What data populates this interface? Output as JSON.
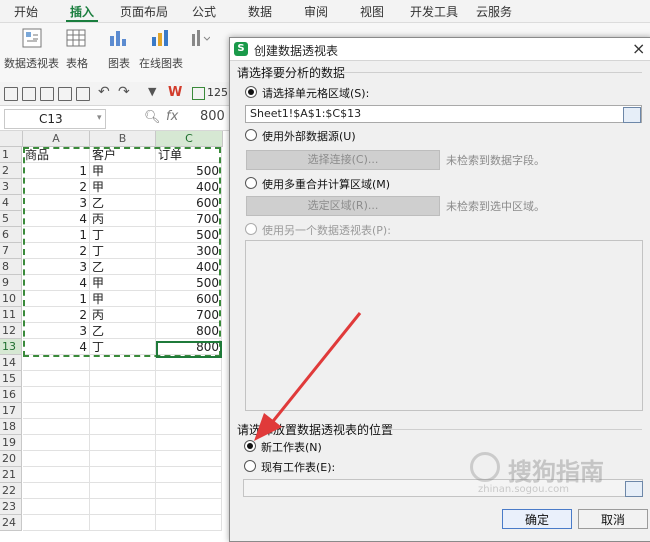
{
  "ribbon": {
    "tabs": [
      "开始",
      "插入",
      "页面布局",
      "公式",
      "数据",
      "审阅",
      "视图",
      "开发工具",
      "云服务"
    ],
    "active_tab": "插入",
    "buttons": [
      "数据透视表",
      "表格",
      "图表",
      "在线图表"
    ]
  },
  "formula_bar": {
    "cell_ref": "C13",
    "fx": "fx",
    "value": "800",
    "zoom": "125"
  },
  "sheet": {
    "columns": [
      "A",
      "B",
      "C"
    ],
    "rows": [
      "1",
      "2",
      "3",
      "4",
      "5",
      "6",
      "7",
      "8",
      "9",
      "10",
      "11",
      "12",
      "13",
      "14",
      "15",
      "16",
      "17",
      "18",
      "19",
      "20",
      "21",
      "22",
      "23",
      "24"
    ],
    "header": [
      "商品",
      "客户",
      "订单"
    ],
    "data": [
      [
        "1",
        "甲",
        "500"
      ],
      [
        "2",
        "甲",
        "400"
      ],
      [
        "3",
        "乙",
        "600"
      ],
      [
        "4",
        "丙",
        "700"
      ],
      [
        "1",
        "丁",
        "500"
      ],
      [
        "2",
        "丁",
        "300"
      ],
      [
        "3",
        "乙",
        "400"
      ],
      [
        "4",
        "甲",
        "500"
      ],
      [
        "1",
        "甲",
        "600"
      ],
      [
        "2",
        "丙",
        "700"
      ],
      [
        "3",
        "乙",
        "800"
      ],
      [
        "4",
        "丁",
        "800"
      ]
    ]
  },
  "dialog": {
    "title": "创建数据透视表",
    "section1": "请选择要分析的数据",
    "opt_range": "请选择单元格区域(S):",
    "range_value": "Sheet1!$A$1:$C$13",
    "opt_external": "使用外部数据源(U)",
    "btn_connect": "选择连接(C)...",
    "hint_connect": "未检索到数据字段。",
    "opt_multi": "使用多重合并计算区域(M)",
    "btn_select": "选定区域(R)...",
    "hint_select": "未检索到选中区域。",
    "opt_other": "使用另一个数据透视表(P):",
    "section2": "请选择放置数据透视表的位置",
    "opt_new": "新工作表(N)",
    "opt_existing": "现有工作表(E):",
    "ok": "确定",
    "cancel": "取消"
  },
  "watermark": {
    "text1": "搜狗指南",
    "text2": "zhinan.sogou.com"
  },
  "colors": {
    "accent": "#1a7e3e",
    "arrow": "#e03a3a",
    "selection": "#3a8a3a"
  }
}
